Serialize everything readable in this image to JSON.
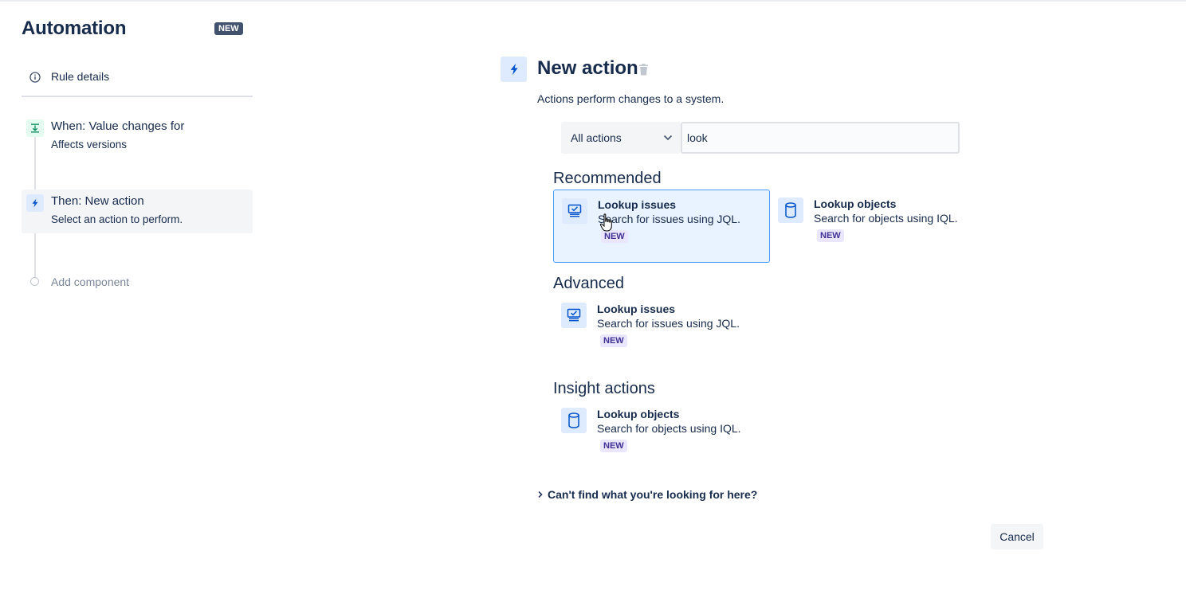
{
  "sidebar": {
    "app_title": "Automation",
    "app_badge": "NEW",
    "rule_details": "Rule details",
    "trigger": {
      "title": "When: Value changes for",
      "subtitle": "Affects versions"
    },
    "action": {
      "title": "Then: New action",
      "subtitle": "Select an action to perform."
    },
    "add_component": "Add component"
  },
  "main": {
    "title": "New action",
    "description": "Actions perform changes to a system.",
    "filter": {
      "selected": "All actions"
    },
    "search": {
      "value": "look"
    },
    "sections": {
      "recommended": {
        "title": "Recommended",
        "items": [
          {
            "title": "Lookup issues",
            "desc": "Search for issues using JQL.",
            "badge": "NEW",
            "icon": "lookup-issues-icon"
          },
          {
            "title": "Lookup objects",
            "desc": "Search for objects using IQL.",
            "badge": "NEW",
            "icon": "database-icon"
          }
        ]
      },
      "advanced": {
        "title": "Advanced",
        "items": [
          {
            "title": "Lookup issues",
            "desc": "Search for issues using JQL.",
            "badge": "NEW",
            "icon": "lookup-issues-icon"
          }
        ]
      },
      "insight": {
        "title": "Insight actions",
        "items": [
          {
            "title": "Lookup objects",
            "desc": "Search for objects using IQL.",
            "badge": "NEW",
            "icon": "database-icon"
          }
        ]
      }
    },
    "cant_find": "Can't find what you're looking for here?",
    "cancel_label": "Cancel"
  },
  "colors": {
    "text": "#172b4d",
    "accent_blue": "#0052cc",
    "selected_bg": "#e9f2ff",
    "selected_border": "#4c9aff",
    "new_lozenge_bg": "#eae6ff",
    "new_lozenge_text": "#403294",
    "trigger_green": "#00875a"
  }
}
